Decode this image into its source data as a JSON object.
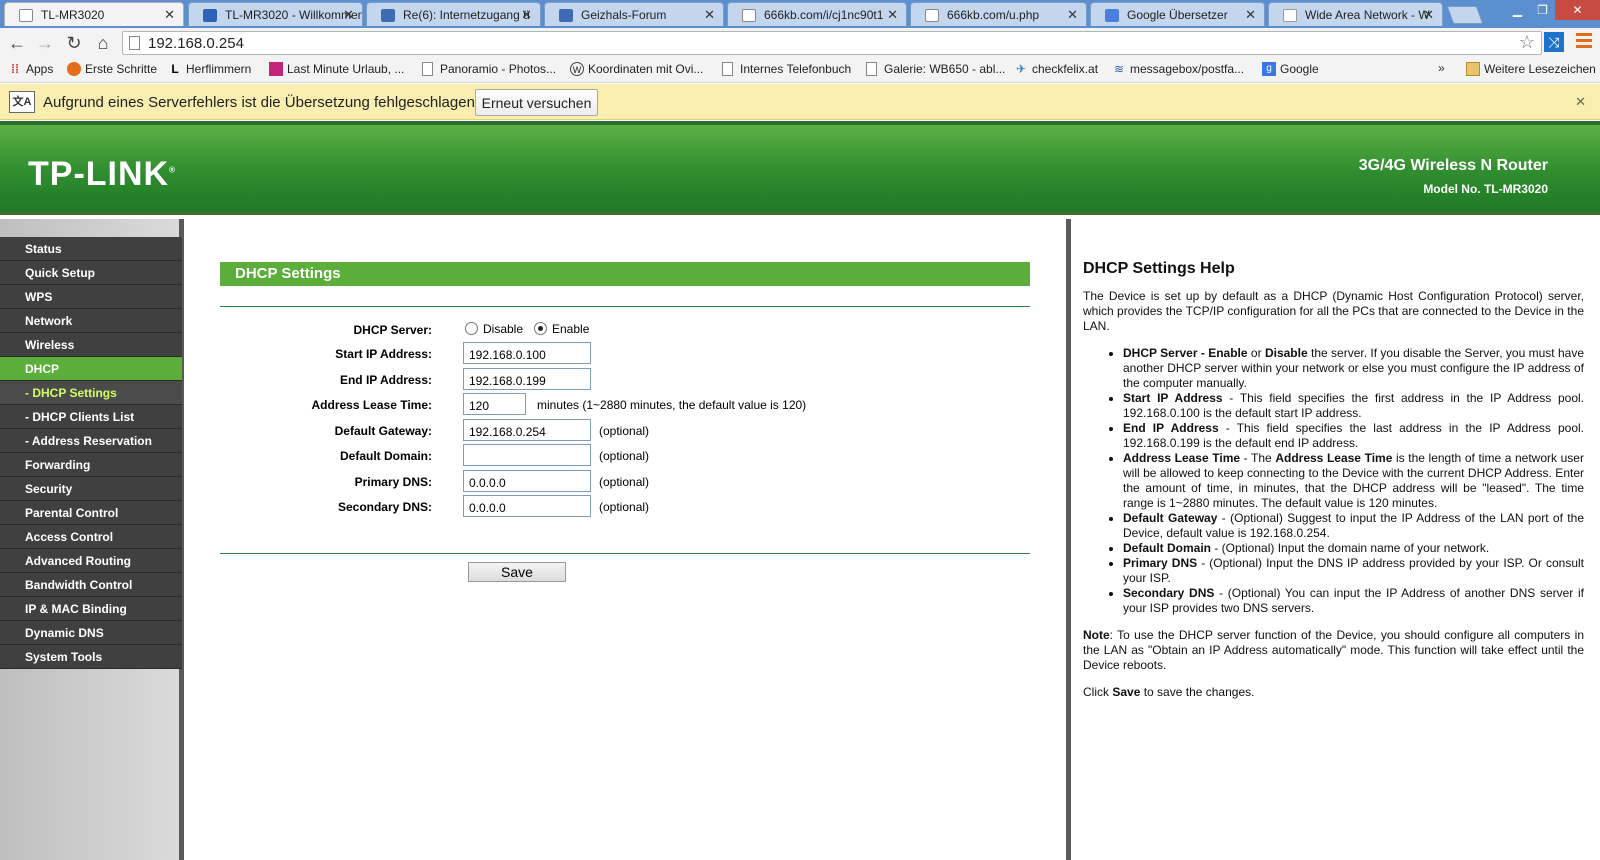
{
  "browser": {
    "tabs": [
      {
        "title": "TL-MR3020",
        "icon": "page"
      },
      {
        "title": "TL-MR3020 - Willkommen",
        "icon": "tp"
      },
      {
        "title": "Re(6): Internetzugang ü",
        "icon": "ghf"
      },
      {
        "title": "Geizhals-Forum",
        "icon": "ghf"
      },
      {
        "title": "666kb.com/i/cj1nc90t1",
        "icon": "page"
      },
      {
        "title": "666kb.com/u.php",
        "icon": "page"
      },
      {
        "title": "Google Übersetzer",
        "icon": "gt"
      },
      {
        "title": "Wide Area Network - W",
        "icon": "w"
      }
    ],
    "url": "192.168.0.254",
    "bookmarks": [
      {
        "label": "Apps",
        "icon": "apps-icon"
      },
      {
        "label": "Erste Schritte",
        "icon": "firefox-icon"
      },
      {
        "label": "Herflimmern",
        "icon": "l-icon"
      },
      {
        "label": "Last Minute Urlaub, ...",
        "icon": "travel-icon"
      },
      {
        "label": "Panoramio - Photos...",
        "icon": "page-icon"
      },
      {
        "label": "Koordinaten mit Ovi...",
        "icon": "wordpress-icon"
      },
      {
        "label": "Internes Telefonbuch",
        "icon": "page-icon"
      },
      {
        "label": "Galerie: WB650 - abl...",
        "icon": "page-icon"
      },
      {
        "label": "checkfelix.at",
        "icon": "plane-icon"
      },
      {
        "label": "messagebox/postfa...",
        "icon": "message-icon"
      },
      {
        "label": "Google",
        "icon": "google-icon"
      }
    ],
    "bookmarks_more": "»",
    "other_bookmarks": "Weitere Lesezeichen",
    "translate_bar": {
      "message": "Aufgrund eines Serverfehlers ist die Übersetzung fehlgeschlagen.",
      "retry_label": "Erneut versuchen"
    }
  },
  "router": {
    "logo": "TP-LINK",
    "product": "3G/4G Wireless N Router",
    "model": "Model No. TL-MR3020"
  },
  "menu": [
    {
      "label": "Status",
      "sub": false,
      "active": false
    },
    {
      "label": "Quick Setup",
      "sub": false,
      "active": false
    },
    {
      "label": "WPS",
      "sub": false,
      "active": false
    },
    {
      "label": "Network",
      "sub": false,
      "active": false
    },
    {
      "label": "Wireless",
      "sub": false,
      "active": false
    },
    {
      "label": "DHCP",
      "sub": false,
      "active": true
    },
    {
      "label": "- DHCP Settings",
      "sub": true,
      "active": true
    },
    {
      "label": "- DHCP Clients List",
      "sub": true,
      "active": false
    },
    {
      "label": "- Address Reservation",
      "sub": true,
      "active": false
    },
    {
      "label": "Forwarding",
      "sub": false,
      "active": false
    },
    {
      "label": "Security",
      "sub": false,
      "active": false
    },
    {
      "label": "Parental Control",
      "sub": false,
      "active": false
    },
    {
      "label": "Access Control",
      "sub": false,
      "active": false
    },
    {
      "label": "Advanced Routing",
      "sub": false,
      "active": false
    },
    {
      "label": "Bandwidth Control",
      "sub": false,
      "active": false
    },
    {
      "label": "IP & MAC Binding",
      "sub": false,
      "active": false
    },
    {
      "label": "Dynamic DNS",
      "sub": false,
      "active": false
    },
    {
      "label": "System Tools",
      "sub": false,
      "active": false
    }
  ],
  "form": {
    "title": "DHCP Settings",
    "dhcp_server_label": "DHCP Server:",
    "disable_label": "Disable",
    "enable_label": "Enable",
    "dhcp_server_value": "enable",
    "start_ip_label": "Start IP Address:",
    "start_ip": "192.168.0.100",
    "end_ip_label": "End IP Address:",
    "end_ip": "192.168.0.199",
    "lease_label": "Address Lease Time:",
    "lease": "120",
    "lease_note": "minutes (1~2880 minutes, the default value is 120)",
    "gateway_label": "Default Gateway:",
    "gateway": "192.168.0.254",
    "domain_label": "Default Domain:",
    "domain": "",
    "primary_dns_label": "Primary DNS:",
    "primary_dns": "0.0.0.0",
    "secondary_dns_label": "Secondary DNS:",
    "secondary_dns": "0.0.0.0",
    "optional": "(optional)",
    "save_label": "Save"
  },
  "help": {
    "title": "DHCP Settings Help",
    "intro": "The Device is set up by default as a DHCP (Dynamic Host Configuration Protocol) server, which provides the TCP/IP configuration for all the PCs that are connected to the Device in the LAN.",
    "items": [
      {
        "term": "DHCP Server - Enable",
        "mid": " or ",
        "term2": "Disable",
        "text": " the server. If you disable the Server, you must have another DHCP server within your network or else you must configure the IP address of the computer manually."
      },
      {
        "term": "Start IP Address",
        "text": " - This field specifies the first address in the IP Address pool. 192.168.0.100 is the default start IP address."
      },
      {
        "term": "End IP Address",
        "text": " - This field specifies the last address in the IP Address pool. 192.168.0.199 is the default end IP address."
      },
      {
        "term": "Address Lease Time",
        "mid": " - The ",
        "term2": "Address Lease Time",
        "text": " is the length of time a network user will be allowed to keep connecting to the Device with the current DHCP Address. Enter the amount of time, in minutes, that the DHCP address will be \"leased\". The time range is 1~2880 minutes. The default value is 120 minutes."
      },
      {
        "term": "Default Gateway",
        "text": " - (Optional) Suggest to input the IP Address of the LAN port of the Device, default value is 192.168.0.254."
      },
      {
        "term": "Default Domain",
        "text": " - (Optional) Input the domain name of your network."
      },
      {
        "term": "Primary DNS",
        "text": " - (Optional) Input the DNS IP address provided by your ISP. Or consult your ISP."
      },
      {
        "term": "Secondary DNS",
        "text": " - (Optional) You can input the IP Address of another DNS server if your ISP provides two DNS servers."
      }
    ],
    "note_term": "Note",
    "note_text": ": To use the DHCP server function of the Device, you should configure all computers in the LAN as \"Obtain an IP Address automatically\" mode. This function will take effect until the Device reboots.",
    "click_pre": "Click ",
    "click_term": "Save",
    "click_post": " to save the changes."
  }
}
